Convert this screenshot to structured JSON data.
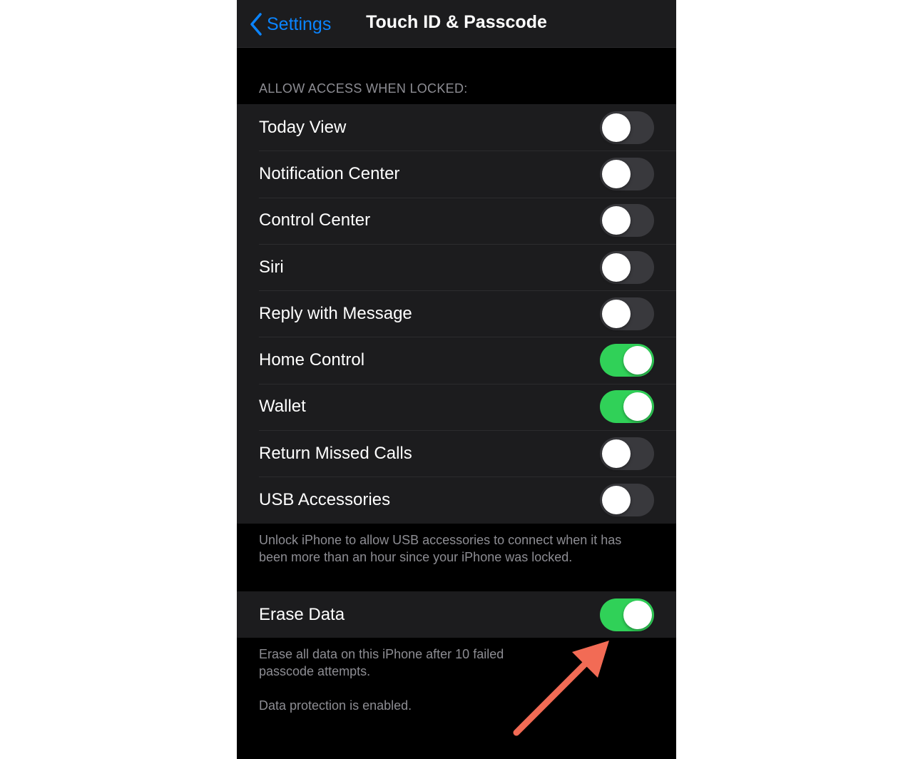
{
  "navbar": {
    "back_label": "Settings",
    "title": "Touch ID & Passcode"
  },
  "section": {
    "header": "ALLOW ACCESS WHEN LOCKED:",
    "items": [
      {
        "label": "Today View",
        "on": false
      },
      {
        "label": "Notification Center",
        "on": false
      },
      {
        "label": "Control Center",
        "on": false
      },
      {
        "label": "Siri",
        "on": false
      },
      {
        "label": "Reply with Message",
        "on": false
      },
      {
        "label": "Home Control",
        "on": true
      },
      {
        "label": "Wallet",
        "on": true
      },
      {
        "label": "Return Missed Calls",
        "on": false
      },
      {
        "label": "USB Accessories",
        "on": false
      }
    ],
    "footer": "Unlock iPhone to allow USB accessories to connect when it has been more than an hour since your iPhone was locked."
  },
  "erase": {
    "label": "Erase Data",
    "on": true,
    "footer": "Erase all data on this iPhone after 10 failed passcode attempts.",
    "protection_note": "Data protection is enabled."
  },
  "colors": {
    "accent_blue": "#0a84ff",
    "toggle_on": "#30d158",
    "toggle_off": "#39393d",
    "annotation_arrow": "#f26b55"
  },
  "icons": {
    "back": "chevron-left-icon",
    "annotation": "arrow-annotation-icon"
  }
}
